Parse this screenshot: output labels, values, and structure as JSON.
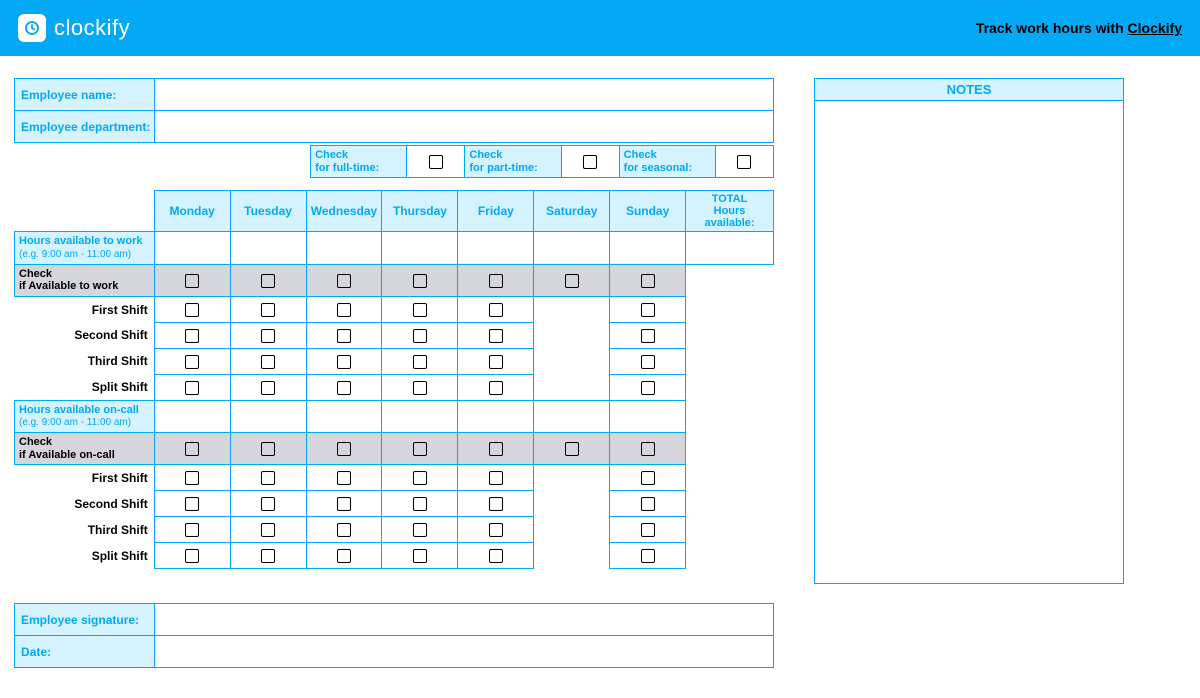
{
  "header": {
    "brand": "clockify",
    "tagline_prefix": "Track work hours with ",
    "tagline_link": "Clockify"
  },
  "meta": {
    "name_label": "Employee name:",
    "dept_label": "Employee department:"
  },
  "type_checks": {
    "fulltime_label": "Check\nfor full-time:",
    "parttime_label": "Check\nfor part-time:",
    "seasonal_label": "Check\nfor seasonal:"
  },
  "days": [
    "Monday",
    "Tuesday",
    "Wednesday",
    "Thursday",
    "Friday",
    "Saturday",
    "Sunday"
  ],
  "total_header": "TOTAL\nHours available:",
  "rows": {
    "hours_work_label": "Hours available to work",
    "hours_work_sub": "(e.g. 9:00 am - 11:00 am)",
    "check_avail_work": "Check\nif Available to work",
    "hours_oncall_label": "Hours available on-call",
    "hours_oncall_sub": "(e.g. 9:00 am - 11:00 am)",
    "check_avail_oncall": "Check\nif Available on-call",
    "shifts": [
      "First Shift",
      "Second Shift",
      "Third Shift",
      "Split Shift"
    ]
  },
  "signature": {
    "sig_label": "Employee signature:",
    "date_label": "Date:"
  },
  "notes": {
    "header": "NOTES"
  }
}
